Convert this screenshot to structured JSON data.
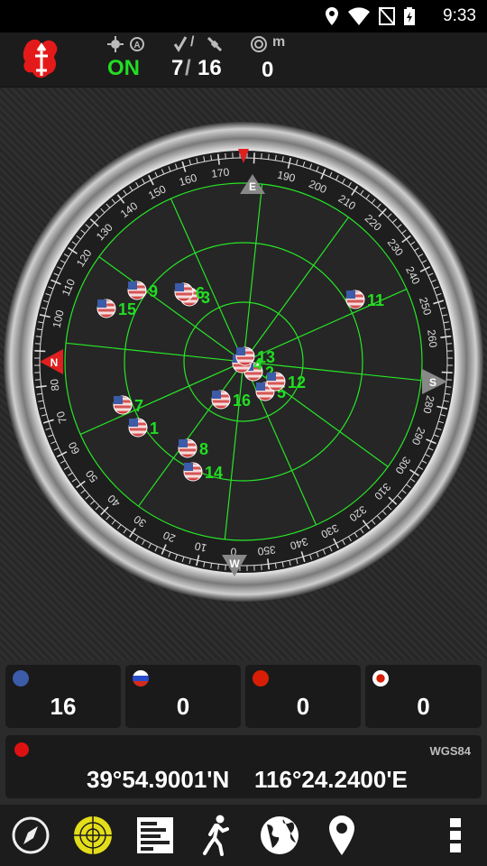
{
  "status_bar": {
    "time": "9:33"
  },
  "header": {
    "fix_status": "ON",
    "satellites_used": "7",
    "satellites_total": "16",
    "separator": "/",
    "altitude": "0",
    "altitude_unit": "m"
  },
  "compass": {
    "north_label": "N",
    "east_label": "E",
    "south_label": "S",
    "west_label": "W",
    "degree_labels": [
      "0",
      "10",
      "20",
      "30",
      "40",
      "50",
      "60",
      "70",
      "80",
      "100",
      "110",
      "120",
      "130",
      "140",
      "150",
      "160",
      "170",
      "190",
      "200",
      "210",
      "220",
      "230",
      "240",
      "250",
      "260",
      "280",
      "290",
      "300",
      "310",
      "320",
      "330",
      "340",
      "350"
    ]
  },
  "satellites": [
    {
      "id": "1"
    },
    {
      "id": "2"
    },
    {
      "id": "3"
    },
    {
      "id": "4"
    },
    {
      "id": "5"
    },
    {
      "id": "6"
    },
    {
      "id": "7"
    },
    {
      "id": "8"
    },
    {
      "id": "9"
    },
    {
      "id": "11"
    },
    {
      "id": "12"
    },
    {
      "id": "13"
    },
    {
      "id": "14"
    },
    {
      "id": "15"
    },
    {
      "id": "16"
    }
  ],
  "constellations": [
    {
      "name": "GPS",
      "flag_color": "#3c5ba8",
      "count": "16"
    },
    {
      "name": "GLONASS",
      "flag_color": "#cc2222",
      "count": "0"
    },
    {
      "name": "BeiDou",
      "flag_color": "#d81e06",
      "count": "0"
    },
    {
      "name": "QZSS",
      "flag_color": "#ffffff",
      "count": "0"
    }
  ],
  "location": {
    "datum": "WGS84",
    "latitude": "39°54.9001'N",
    "longitude": "116°24.2400'E"
  },
  "colors": {
    "accent_green": "#22dd22",
    "grid_green": "#27e627",
    "red": "#e02020"
  }
}
